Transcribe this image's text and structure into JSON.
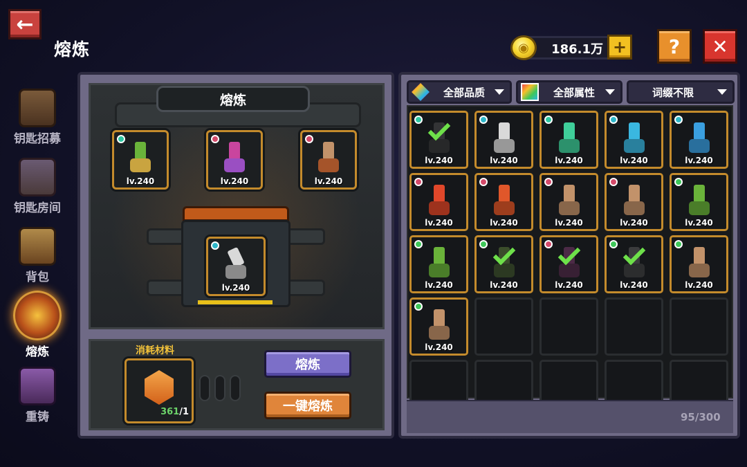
{
  "header": {
    "back_label": "←",
    "title": "熔炼",
    "coin_value": "186.1万",
    "plus_label": "+",
    "help_label": "?",
    "close_label": "✕"
  },
  "sidebar": {
    "items": [
      {
        "label": "钥匙招募",
        "active": false
      },
      {
        "label": "钥匙房间",
        "active": false
      },
      {
        "label": "背包",
        "active": false
      },
      {
        "label": "熔炼",
        "active": true
      },
      {
        "label": "重铸",
        "active": false
      }
    ]
  },
  "smelt": {
    "pane_title": "熔炼",
    "input_slots": [
      {
        "level": "lv.240",
        "gem": "teal",
        "key_color": "#6ab33a"
      },
      {
        "level": "lv.240",
        "gem": "red",
        "key_color": "#c9459e"
      },
      {
        "level": "lv.240",
        "gem": "red",
        "key_color": "#c2926a"
      }
    ],
    "result_slot": {
      "level": "lv.240",
      "gem": "cyan",
      "key_color": "#d9d9d9"
    },
    "material_label": "消耗材料",
    "material_count_have": "361",
    "material_count_need": "/1",
    "smelt_button": "熔炼",
    "one_key_button": "一键熔炼"
  },
  "filters": {
    "quality": "全部品质",
    "attribute": "全部属性",
    "affix": "词缀不限"
  },
  "inventory": {
    "capacity": "95/300",
    "items": [
      {
        "level": "lv.240",
        "gem": "teal",
        "color": "#4d4d4d",
        "checked": true
      },
      {
        "level": "lv.240",
        "gem": "cyan",
        "color": "#d9d9d9",
        "checked": false
      },
      {
        "level": "lv.240",
        "gem": "teal",
        "color": "#3fcf9a",
        "checked": false
      },
      {
        "level": "lv.240",
        "gem": "cyan",
        "color": "#3ab7e0",
        "checked": false
      },
      {
        "level": "lv.240",
        "gem": "cyan",
        "color": "#3a9fe0",
        "checked": false
      },
      {
        "level": "lv.240",
        "gem": "red",
        "color": "#e0472a",
        "checked": false
      },
      {
        "level": "lv.240",
        "gem": "red",
        "color": "#e0572a",
        "checked": false
      },
      {
        "level": "lv.240",
        "gem": "red",
        "color": "#c2926a",
        "checked": false
      },
      {
        "level": "lv.240",
        "gem": "red",
        "color": "#c2926a",
        "checked": false
      },
      {
        "level": "lv.240",
        "gem": "green",
        "color": "#6ab33a",
        "checked": false
      },
      {
        "level": "lv.240",
        "gem": "green",
        "color": "#6ab33a",
        "checked": false
      },
      {
        "level": "lv.240",
        "gem": "green",
        "color": "#5a7a3a",
        "checked": true
      },
      {
        "level": "lv.240",
        "gem": "red",
        "color": "#7a3a6a",
        "checked": true
      },
      {
        "level": "lv.240",
        "gem": "green",
        "color": "#5a5a5a",
        "checked": true
      },
      {
        "level": "lv.240",
        "gem": "green",
        "color": "#c2926a",
        "checked": false
      },
      {
        "level": "lv.240",
        "gem": "green",
        "color": "#c2926a",
        "checked": false
      }
    ]
  },
  "colors": {
    "panel": "#6f6a86",
    "slot_border": "#c48b2c",
    "smelt_button": "#7c6fc8",
    "one_key_button": "#e0853a"
  }
}
